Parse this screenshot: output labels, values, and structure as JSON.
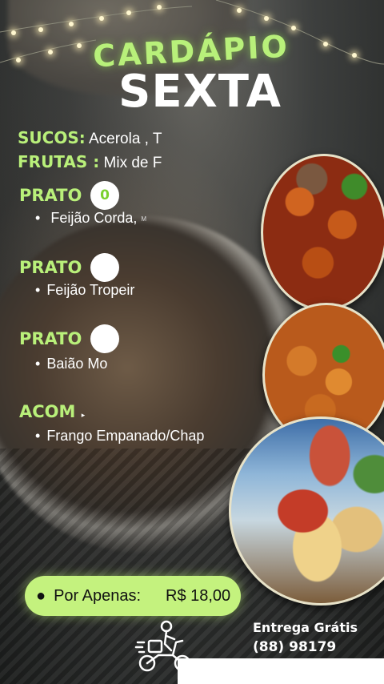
{
  "header": {
    "title_top": "CARDÁPIO",
    "title_day": "SEXTA"
  },
  "info": {
    "sucos_label": "SUCOS:",
    "sucos_value": "Acerola , T",
    "frutas_label": "FRUTAS :",
    "frutas_value": "Mix de F"
  },
  "dishes": [
    {
      "label": "PRATO",
      "badge": "0",
      "item": "Feijão Corda,",
      "item_extra": "M"
    },
    {
      "label": "PRATO",
      "badge": "",
      "item": "Feijão Tropeir"
    },
    {
      "label": "PRATO",
      "badge": "",
      "item": "Baião Mo"
    }
  ],
  "side": {
    "label": "ACOM",
    "marker": "▸",
    "item": "Frango Empanado/Chap"
  },
  "price": {
    "label": "Por Apenas:",
    "value": "R$ 18,00"
  },
  "delivery": {
    "text": "Entrega  Grátis",
    "phone": "(88) 98179"
  },
  "icons": [
    "string-lights",
    "delivery-scooter-icon"
  ],
  "colors": {
    "accent_green": "#b9f07a",
    "price_pill": "#c4f27e",
    "text_white": "#ffffff"
  }
}
